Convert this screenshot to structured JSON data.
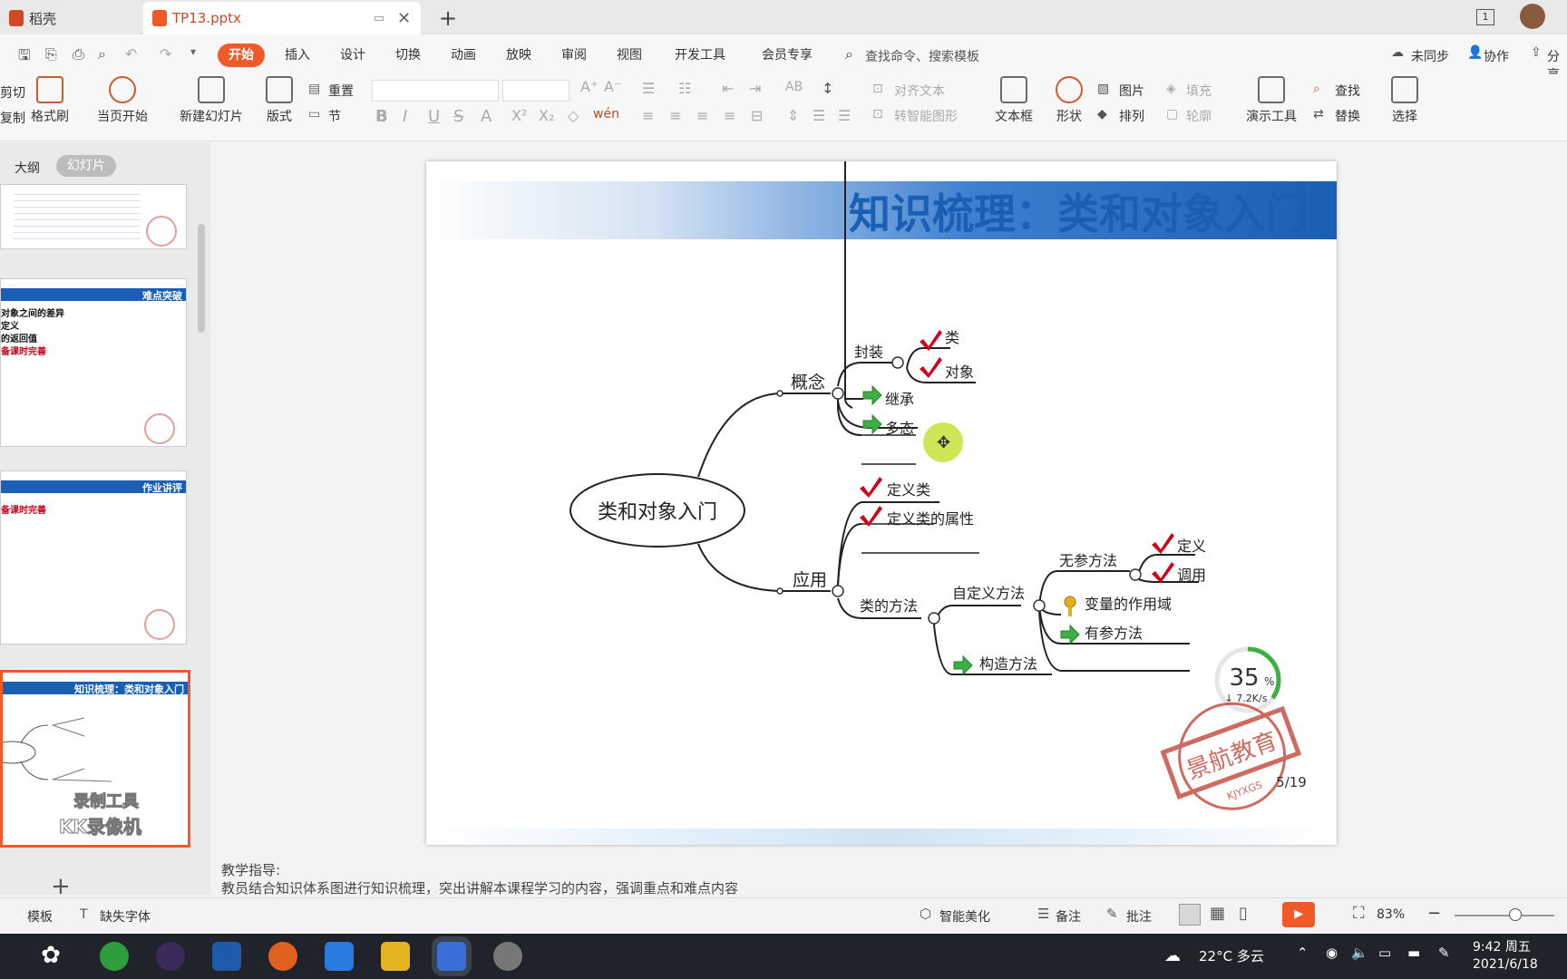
{
  "titlebar": {
    "home_tab": "稻壳",
    "doc_tab": "TP13.pptx",
    "window_badge": "1"
  },
  "menu": {
    "items": [
      "开始",
      "插入",
      "设计",
      "切换",
      "动画",
      "放映",
      "审阅",
      "视图",
      "开发工具",
      "会员专享"
    ],
    "search_placeholder": "查找命令、搜索模板",
    "right": [
      "未同步",
      "协作",
      "分享"
    ]
  },
  "ribbon": {
    "cut": "剪切",
    "copy": "复制",
    "format_painter": "格式刷",
    "from_current": "当页开始",
    "new_slide": "新建幻灯片",
    "layout": "版式",
    "reset": "重置",
    "section": "节",
    "align_text": "对齐文本",
    "to_smartart": "转智能图形",
    "textbox": "文本框",
    "shape": "形状",
    "picture": "图片",
    "fill": "填充",
    "arrange": "排列",
    "outline": "轮廓",
    "present_tools": "演示工具",
    "find": "查找",
    "replace": "替换",
    "select": "选择"
  },
  "leftpanel": {
    "tab_outline": "大纲",
    "tab_slides": "幻灯片",
    "thumb2_title": "难点突破",
    "thumb2_lines": [
      "对象之间的差异",
      "定义",
      "的返回值",
      "备课时完善"
    ],
    "thumb3_title": "作业讲评",
    "thumb3_line": "备课时完善",
    "thumb4_title": "知识梳理：类和对象入门",
    "watermark1": "录制工具",
    "watermark2": "KK录像机"
  },
  "slide": {
    "title": "知识梳理：类和对象入门",
    "page": "5/19",
    "root": "类和对象入门",
    "concept": "概念",
    "encapsulation": "封装",
    "cls": "类",
    "obj": "对象",
    "inherit": "继承",
    "poly": "多态",
    "apply": "应用",
    "def_class": "定义类",
    "def_attr": "定义类的属性",
    "cls_method": "类的方法",
    "custom_method": "自定义方法",
    "no_param": "无参方法",
    "define": "定义",
    "invoke": "调用",
    "var_scope": "变量的作用域",
    "param_method": "有参方法",
    "constructor": "构造方法",
    "stamp": "景航教育",
    "stamp_sub": "KJYXGS",
    "progress_pct": "35",
    "progress_unit": "%",
    "progress_speed": "↓ 7.2K/s"
  },
  "notes": {
    "line1": "教学指导:",
    "line2": "教员结合知识体系图进行知识梳理，突出讲解本课程学习的内容，强调重点和难点内容"
  },
  "statusbar": {
    "template": "模板",
    "missing_font": "缺失字体",
    "beautify": "智能美化",
    "remarks": "备注",
    "comments": "批注",
    "zoom": "83%"
  },
  "taskbar": {
    "weather": "22°C 多云",
    "time": "9:42 周五",
    "date": "2021/6/18"
  },
  "colors": {
    "accent": "#f05a28",
    "title_blue": "#1a5fb4",
    "check_red": "#d0021b",
    "arrow_green": "#3cb043",
    "stamp_red": "#c0392b"
  }
}
